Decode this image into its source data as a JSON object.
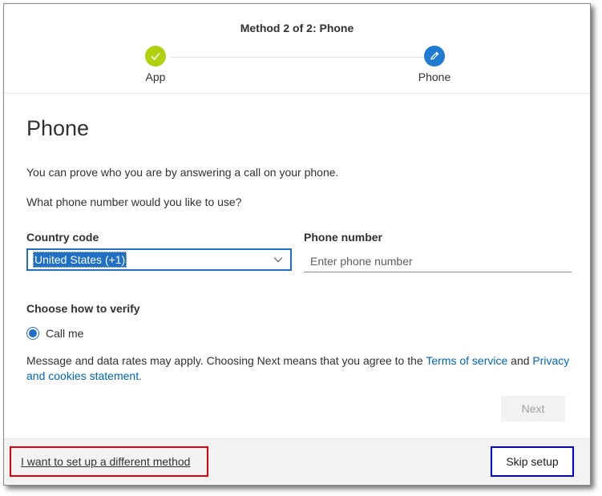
{
  "header": {
    "method_title": "Method 2 of 2: Phone",
    "steps": [
      {
        "label": "App",
        "state": "completed",
        "icon": "checkmark-icon"
      },
      {
        "label": "Phone",
        "state": "current",
        "icon": "pencil-icon"
      }
    ]
  },
  "main": {
    "title": "Phone",
    "intro": "You can prove who you are by answering a call on your phone.",
    "question": "What phone number would you like to use?",
    "country_code_label": "Country code",
    "country_code_value": "United States (+1)",
    "phone_number_label": "Phone number",
    "phone_number_placeholder": "Enter phone number",
    "phone_number_value": "",
    "verify_label": "Choose how to verify",
    "verify_option": "Call me",
    "disclaimer_prefix": "Message and data rates may apply. Choosing Next means that you agree to the ",
    "terms_link": "Terms of service",
    "disclaimer_and": " and ",
    "privacy_link": "Privacy and cookies statement.",
    "next_button": "Next"
  },
  "footer": {
    "alt_method_link": "I want to set up a different method",
    "skip_button": "Skip setup"
  },
  "colors": {
    "accent": "#1f6fc5",
    "step_done": "#b0d10f",
    "link": "#0067b8",
    "highlight_red": "#e60000",
    "highlight_blue": "#0000e0"
  }
}
